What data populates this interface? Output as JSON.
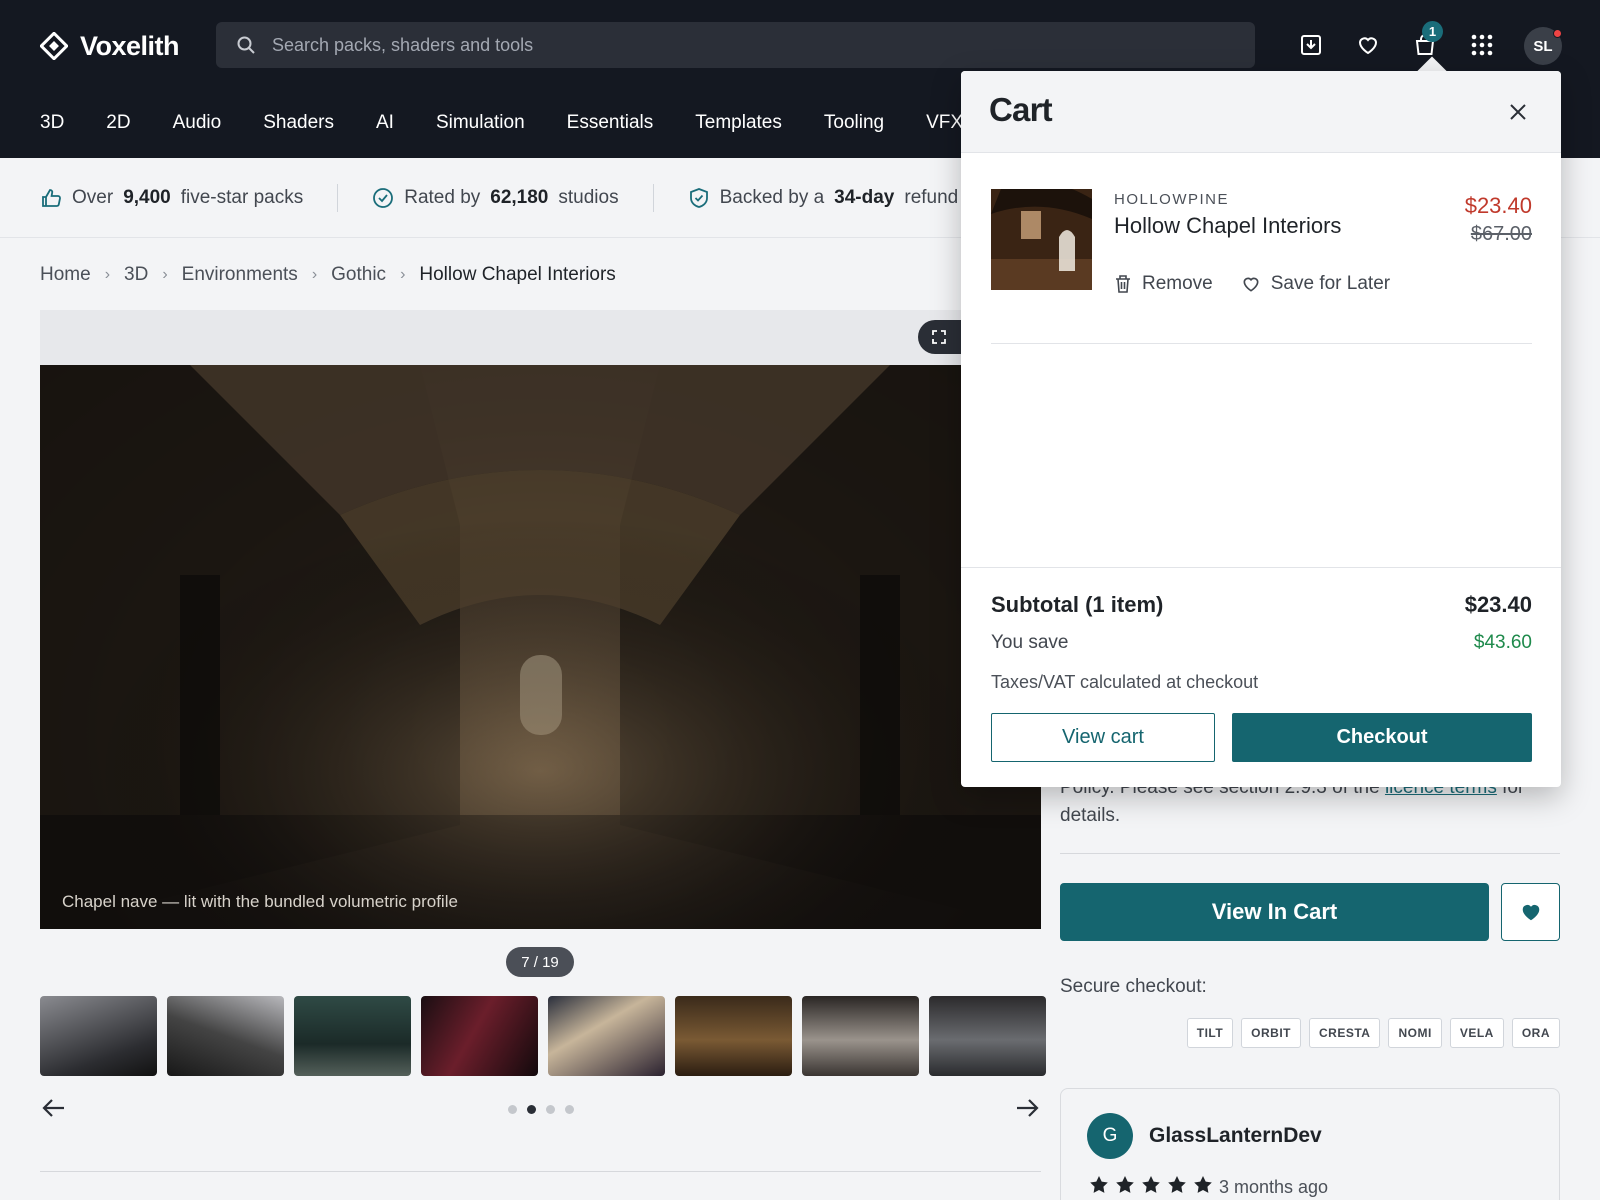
{
  "header": {
    "logo_text": "Voxelith",
    "search_placeholder": "Search packs, shaders and tools",
    "cart_count": "1",
    "avatar_initials": "SL",
    "icons": [
      "download-icon",
      "heart-icon",
      "bag-icon",
      "apps-grid-icon"
    ]
  },
  "categories": [
    "3D",
    "2D",
    "Audio",
    "Shaders",
    "AI",
    "Simulation",
    "Essentials",
    "Templates",
    "Tooling",
    "VFX"
  ],
  "trust": {
    "pre1": "Over",
    "num1": "9,400",
    "post1": "five-star packs",
    "pre2": "Rated by",
    "num2": "62,180",
    "post2": "studios",
    "pre3": "Backed by a",
    "num3": "34-day",
    "post3": "refund"
  },
  "breadcrumb": [
    "Home",
    "3D",
    "Environments",
    "Gothic",
    "Hollow Chapel Interiors"
  ],
  "gallery": {
    "caption": "Chapel nave — lit with the bundled volumetric profile",
    "counter": "7 / 19",
    "thumb_count": 8,
    "active_dot": 1,
    "dot_count": 4
  },
  "product_side": {
    "policy_line1": "Policy. Please see section 2.9.3 of the",
    "policy_link": "licence terms",
    "policy_line1_end": "for",
    "policy_line2": "details.",
    "view_in_cart": "View In Cart",
    "secure_label": "Secure checkout:",
    "payment_methods": [
      "TILT",
      "ORBIT",
      "CRESTA",
      "NOMI",
      "VELA",
      "ORA"
    ]
  },
  "review": {
    "initial": "G",
    "name": "GlassLanternDev",
    "stars": 5,
    "date": "3 months ago"
  },
  "cart": {
    "title": "Cart",
    "item": {
      "vendor": "HOLLOWPINE",
      "name": "Hollow Chapel Interiors",
      "price": "$23.40",
      "original_price": "$67.00",
      "remove_label": "Remove",
      "save_label": "Save for Later"
    },
    "subtotal_label": "Subtotal (1 item)",
    "subtotal_value": "$23.40",
    "save_label": "You save",
    "save_value": "$43.60",
    "tax_note": "Taxes/VAT calculated at checkout",
    "view_cart": "View cart",
    "checkout": "Checkout"
  },
  "colors": {
    "header_bg": "#141821",
    "accent": "#15656f",
    "price_red": "#c0392b",
    "save_green": "#1f8a4c"
  }
}
